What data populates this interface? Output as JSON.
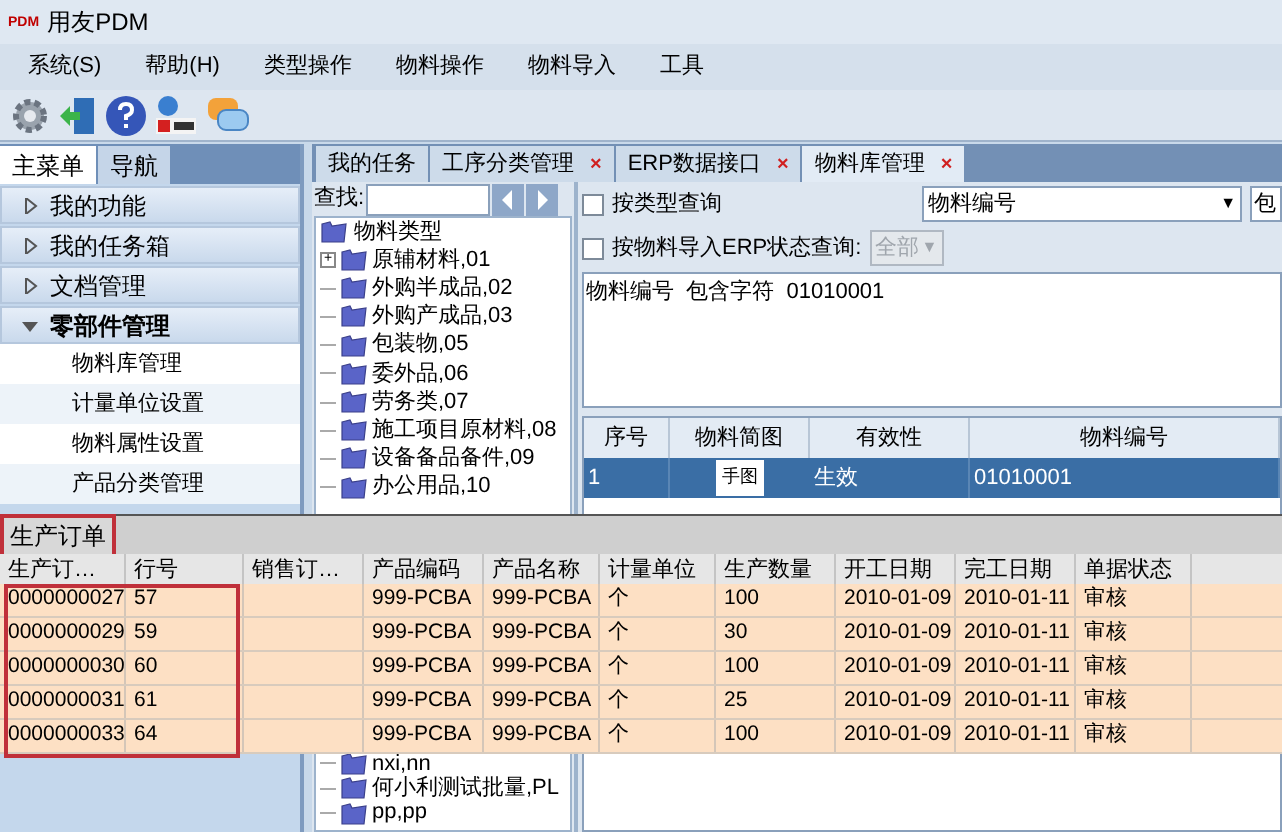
{
  "window": {
    "logo": "PDM",
    "title": "用友PDM"
  },
  "menu": [
    "系统(S)",
    "帮助(H)",
    "类型操作",
    "物料操作",
    "物料导入",
    "工具"
  ],
  "sidebar": {
    "tabs": [
      {
        "label": "主菜单",
        "selected": true
      },
      {
        "label": "导航",
        "selected": false
      }
    ],
    "groups": [
      {
        "label": "我的功能",
        "expanded": false
      },
      {
        "label": "我的任务箱",
        "expanded": false
      },
      {
        "label": "文档管理",
        "expanded": false
      },
      {
        "label": "零部件管理",
        "expanded": true,
        "items": [
          "物料库管理",
          "计量单位设置",
          "物料属性设置",
          "产品分类管理"
        ]
      }
    ]
  },
  "tabs": [
    {
      "label": "我的任务",
      "selected": false
    },
    {
      "label": "工序分类管理",
      "close": "×",
      "selected": false
    },
    {
      "label": "ERP数据接口",
      "close": "×",
      "selected": false
    },
    {
      "label": "物料库管理",
      "close": "×",
      "selected": true
    }
  ],
  "tree": {
    "search_label": "查找:",
    "root": "物料类型",
    "children": [
      {
        "label": "原辅材料,01",
        "kind": "group",
        "expander": "+"
      },
      {
        "label": "外购半成品,02",
        "kind": "leaf"
      },
      {
        "label": "外购产成品,03",
        "kind": "leaf"
      },
      {
        "label": "包装物,05",
        "kind": "leaf"
      },
      {
        "label": "委外品,06",
        "kind": "leaf"
      },
      {
        "label": "劳务类,07",
        "kind": "leaf"
      },
      {
        "label": "施工项目原材料,08",
        "kind": "leaf"
      },
      {
        "label": "设备备品备件,09",
        "kind": "leaf"
      },
      {
        "label": "办公用品,10",
        "kind": "leaf"
      }
    ],
    "children_below": [
      {
        "label": "nxi,nn",
        "kind": "leaf"
      },
      {
        "label": "何小利测试批量,PL",
        "kind": "leaf"
      },
      {
        "label": "pp,pp",
        "kind": "leaf"
      }
    ]
  },
  "query": {
    "by_type": {
      "label": "按类型查询",
      "checked": false
    },
    "field_select": {
      "value": "物料编号",
      "arrow": "▼"
    },
    "operator_select": "包",
    "by_erp": {
      "label": "按物料导入ERP状态查询:",
      "checked": false
    },
    "erp_select": {
      "value": "全部",
      "arrow": "▼",
      "disabled": true
    },
    "condition": "物料编号  包含字符  01010001"
  },
  "material_table": {
    "columns": [
      "序号",
      "物料简图",
      "有效性",
      "物料编号"
    ],
    "rows": [
      {
        "cells": [
          "1",
          "手图",
          "生效",
          "01010001"
        ],
        "selected": true
      }
    ]
  },
  "order_panel": {
    "tab": {
      "label": "生产订单",
      "highlighted": true
    },
    "columns": [
      {
        "label": "生产订…",
        "highlighted": true
      },
      {
        "label": "行号",
        "highlighted": true
      },
      {
        "label": "销售订…",
        "highlighted": false
      },
      {
        "label": "产品编码",
        "highlighted": false
      },
      {
        "label": "产品名称",
        "highlighted": false
      },
      {
        "label": "计量单位",
        "highlighted": false
      },
      {
        "label": "生产数量",
        "highlighted": false
      },
      {
        "label": "开工日期",
        "highlighted": false
      },
      {
        "label": "完工日期",
        "highlighted": false
      },
      {
        "label": "单据状态",
        "highlighted": false
      }
    ],
    "rows": [
      [
        "0000000027",
        "57",
        "",
        "999-PCBA",
        "999-PCBA",
        "个",
        "100",
        "2010-01-09",
        "2010-01-11",
        "审核"
      ],
      [
        "0000000029",
        "59",
        "",
        "999-PCBA",
        "999-PCBA",
        "个",
        "30",
        "2010-01-09",
        "2010-01-11",
        "审核"
      ],
      [
        "0000000030",
        "60",
        "",
        "999-PCBA",
        "999-PCBA",
        "个",
        "100",
        "2010-01-09",
        "2010-01-11",
        "审核"
      ],
      [
        "0000000031",
        "61",
        "",
        "999-PCBA",
        "999-PCBA",
        "个",
        "25",
        "2010-01-09",
        "2010-01-11",
        "审核"
      ],
      [
        "0000000033",
        "64",
        "",
        "999-PCBA",
        "999-PCBA",
        "个",
        "100",
        "2010-01-09",
        "2010-01-11",
        "审核"
      ]
    ]
  }
}
